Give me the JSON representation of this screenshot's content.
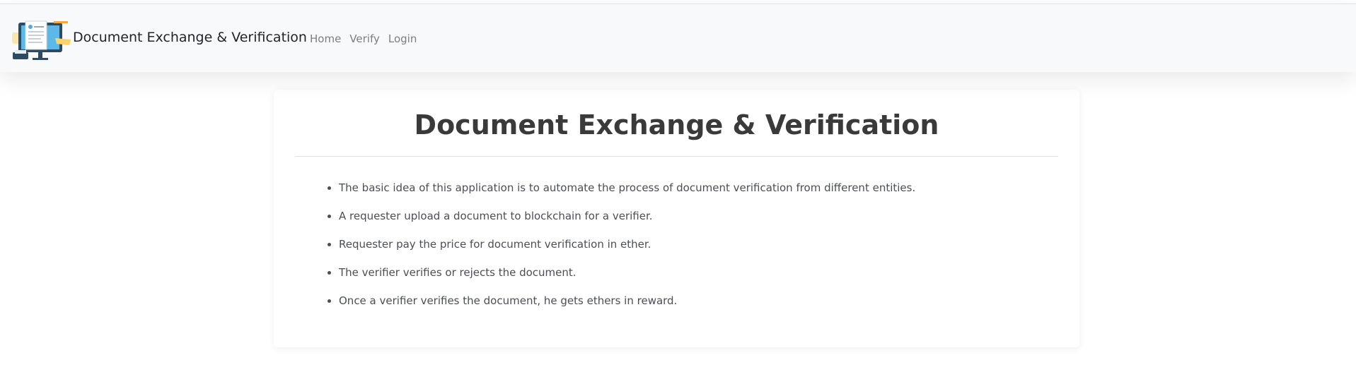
{
  "navbar": {
    "logo_icon": "document-computer-illustration",
    "brand": "Document Exchange & Verification",
    "links": [
      {
        "label": "Home"
      },
      {
        "label": "Verify"
      },
      {
        "label": "Login"
      }
    ]
  },
  "main": {
    "title": "Document Exchange & Verification",
    "points": [
      "The basic idea of this application is to automate the process of document verification from different entities.",
      "A requester upload a document to blockchain for a verifier.",
      "Requester pay the price for document verification in ether.",
      "The verifier verifies or rejects the document.",
      "Once a verifier verifies the document, he gets ethers in reward."
    ]
  },
  "colors": {
    "navbar_bg": "#f8f9fa",
    "nav_link": "#7a7f85",
    "title": "#3a3a3a"
  }
}
